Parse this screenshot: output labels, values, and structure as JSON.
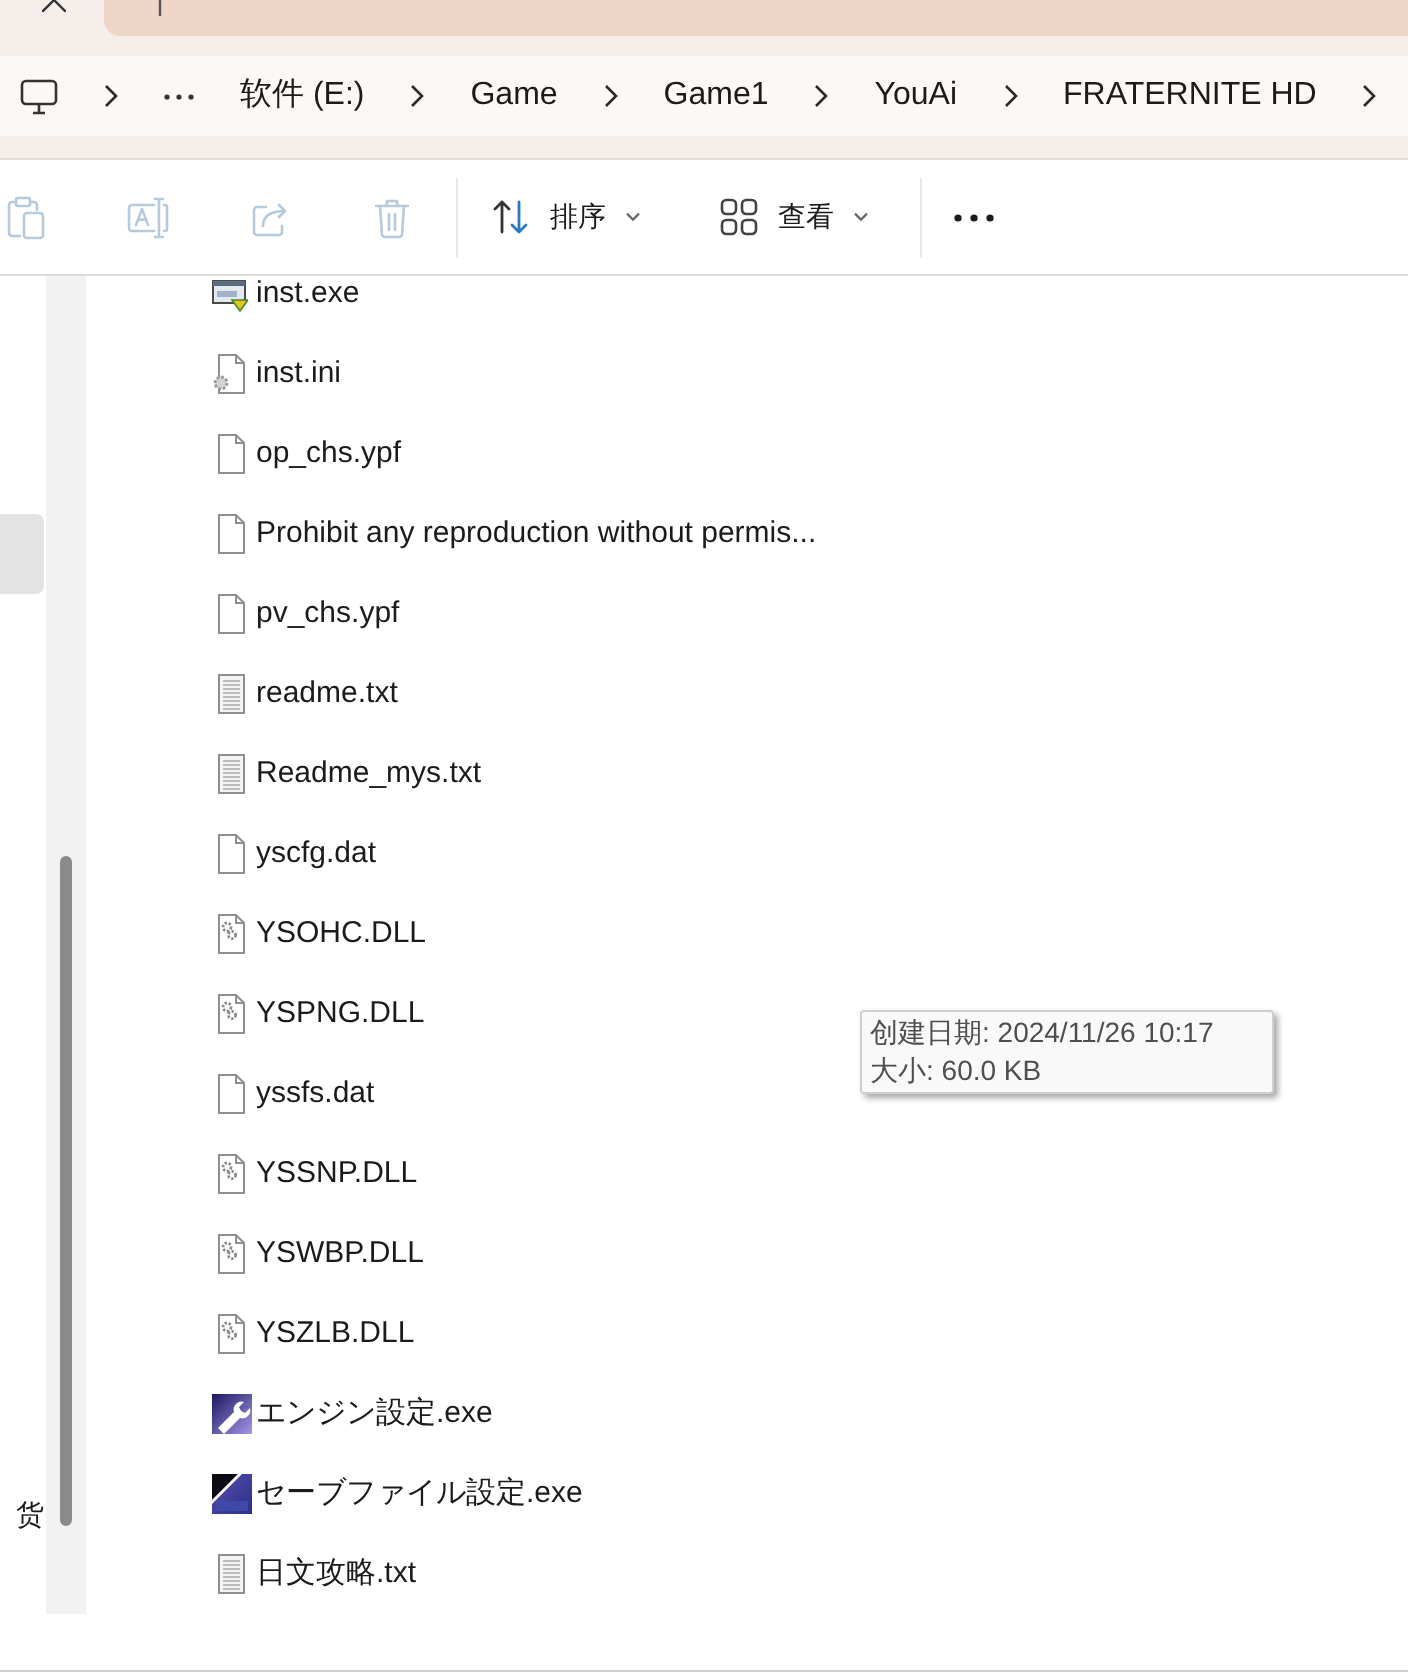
{
  "breadcrumb": {
    "items": [
      {
        "label": "软件 (E:)"
      },
      {
        "label": "Game"
      },
      {
        "label": "Game1"
      },
      {
        "label": "YouAi"
      },
      {
        "label": "FRATERNITE HD"
      }
    ]
  },
  "toolbar": {
    "icon_actions": [
      {
        "kind": "paste",
        "disabled": true
      },
      {
        "kind": "rename",
        "disabled": true
      },
      {
        "kind": "share",
        "disabled": true
      },
      {
        "kind": "delete",
        "disabled": true
      }
    ],
    "menus": [
      {
        "kind": "sort",
        "label": "排序"
      },
      {
        "kind": "view",
        "label": "查看"
      }
    ]
  },
  "sidebar": {
    "items": [
      {
        "selected": true
      },
      {
        "label": "货",
        "selected": false
      }
    ]
  },
  "files": [
    {
      "name": "inst.exe",
      "kind": "setup"
    },
    {
      "name": "inst.ini",
      "kind": "config"
    },
    {
      "name": "op_chs.ypf",
      "kind": "blank"
    },
    {
      "name": "Prohibit any reproduction without permis...",
      "kind": "blank"
    },
    {
      "name": "pv_chs.ypf",
      "kind": "blank"
    },
    {
      "name": "readme.txt",
      "kind": "text"
    },
    {
      "name": "Readme_mys.txt",
      "kind": "text"
    },
    {
      "name": "yscfg.dat",
      "kind": "blank"
    },
    {
      "name": "YSOHC.DLL",
      "kind": "library"
    },
    {
      "name": "YSPNG.DLL",
      "kind": "library"
    },
    {
      "name": "yssfs.dat",
      "kind": "blank"
    },
    {
      "name": "YSSNP.DLL",
      "kind": "library"
    },
    {
      "name": "YSWBP.DLL",
      "kind": "library"
    },
    {
      "name": "YSZLB.DLL",
      "kind": "library"
    },
    {
      "name": "エンジン設定.exe",
      "kind": "wrench-app"
    },
    {
      "name": "セーブファイル設定.exe",
      "kind": "sfs-app"
    },
    {
      "name": "日文攻略.txt",
      "kind": "text"
    }
  ],
  "tooltip": {
    "lines": [
      "创建日期: 2024/11/26 10:17",
      "大小: 60.0 KB"
    ]
  }
}
